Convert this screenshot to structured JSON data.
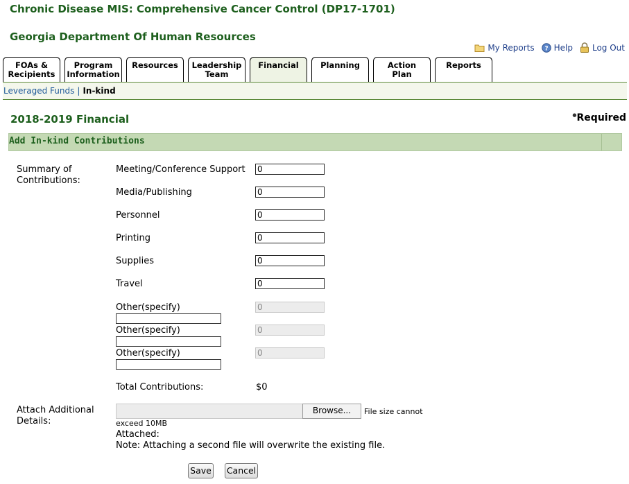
{
  "header": {
    "app_title": "Chronic Disease MIS: Comprehensive Cancer Control (DP17-1701)",
    "org": "Georgia Department Of Human Resources",
    "links": {
      "my_reports": "My Reports",
      "help": "Help",
      "log_out": "Log Out"
    }
  },
  "tabs": [
    {
      "line1": "FOAs &",
      "line2": "Recipients"
    },
    {
      "line1": "Program",
      "line2": "Information"
    },
    {
      "line1": "Resources",
      "line2": ""
    },
    {
      "line1": "Leadership",
      "line2": "Team"
    },
    {
      "line1": "Financial",
      "line2": ""
    },
    {
      "line1": "Planning",
      "line2": ""
    },
    {
      "line1": "Action",
      "line2": "Plan"
    },
    {
      "line1": "Reports",
      "line2": ""
    }
  ],
  "subnav": {
    "leveraged": "Leveraged Funds",
    "sep": "|",
    "current": "In-kind"
  },
  "page": {
    "year_title": "2018-2019 Financial",
    "required": "Required",
    "section_title": "Add In-kind Contributions"
  },
  "form": {
    "summary_label_1": "Summary of",
    "summary_label_2": "Contributions:",
    "fields": [
      {
        "label": "Meeting/Conference Support",
        "value": "0"
      },
      {
        "label": "Media/Publishing",
        "value": "0"
      },
      {
        "label": "Personnel",
        "value": "0"
      },
      {
        "label": "Printing",
        "value": "0"
      },
      {
        "label": "Supplies",
        "value": "0"
      },
      {
        "label": "Travel",
        "value": "0"
      }
    ],
    "other_fields": [
      {
        "label": "Other(specify)",
        "value": "0"
      },
      {
        "label": "Other(specify)",
        "value": "0"
      },
      {
        "label": "Other(specify)",
        "value": "0"
      }
    ],
    "total_label": "Total Contributions:",
    "total_value": "$0",
    "attach_label_1": "Attach Additional",
    "attach_label_2": "Details:",
    "browse_label": "Browse...",
    "size_note_1": "File size cannot",
    "size_note_2": "exceed 10MB",
    "attached_label": "Attached:",
    "overwrite_note": "Note: Attaching a second file will overwrite the existing file.",
    "save_label": "Save",
    "cancel_label": "Cancel"
  }
}
